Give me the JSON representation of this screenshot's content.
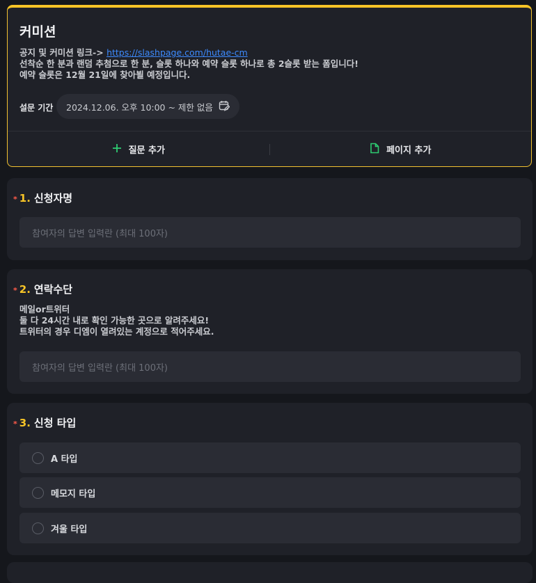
{
  "header": {
    "title": "커미션",
    "notice_prefix": "공지 및 커미션 링크-> ",
    "notice_link": "https://slashpage.com/hutae-cm",
    "line2": "선착순 한 분과 랜덤 추첨으로 한 분, 슬롯 하나와 예약 슬롯 하나로 총 2슬롯 받는 폼입니다!",
    "line3": "예약 슬롯은 12월 21일에 찾아뵐 예정입니다.",
    "period_label": "설문 기간",
    "period_value": "2024.12.06. 오후 10:00 ~ 제한 없음",
    "add_question": "질문 추가",
    "add_page": "페이지 추가"
  },
  "questions": [
    {
      "number": "1.",
      "title": "신청자명",
      "required_mark": "*",
      "placeholder": "참여자의 답변 입력란 (최대 100자)"
    },
    {
      "number": "2.",
      "title": "연락수단",
      "required_mark": "*",
      "description": [
        "메일or트위터",
        "둘 다 24시간 내로 확인 가능한 곳으로 알려주세요!",
        "트위터의 경우 디엠이 열려있는 계정으로 적어주세요."
      ],
      "placeholder": "참여자의 답변 입력란 (최대 100자)"
    },
    {
      "number": "3.",
      "title": "신청 타입",
      "required_mark": "*",
      "options": [
        "A 타입",
        "메모지 타입",
        "겨울 타입"
      ]
    }
  ],
  "colors": {
    "accent": "#f7c427",
    "required": "#ff5b4a",
    "link": "#3d8bff",
    "green": "#2ecc71"
  }
}
